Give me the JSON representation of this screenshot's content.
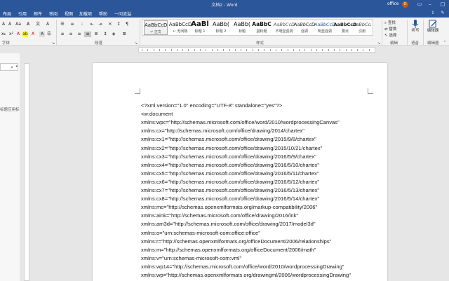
{
  "titlebar": {
    "title": "文档2 - Word",
    "user": "office",
    "avatar": "O",
    "colors": {
      "bar": "#2b579a"
    }
  },
  "tabs": {
    "items": [
      "布局",
      "引用",
      "邮件",
      "审阅",
      "视图",
      "加载项",
      "帮助",
      "一问流溢"
    ],
    "right_icons": [
      "share-icon",
      "comment-icon"
    ]
  },
  "ribbon": {
    "groups": {
      "font": "字体",
      "paragraph": "段落",
      "styles": "样式",
      "editing": "编辑",
      "voice": "语音",
      "editor": "编辑器"
    },
    "styles": [
      {
        "preview": "AaBbCcD",
        "label": "↵ 正文",
        "selected": true
      },
      {
        "preview": "AaBbCcD",
        "label": "↵ 无间隔",
        "selected": false
      },
      {
        "preview": "AaBl",
        "label": "标题 1",
        "selected": false
      },
      {
        "preview": "AaBb(",
        "label": "标题 2",
        "selected": false
      },
      {
        "preview": "AaBb(",
        "label": "标题",
        "selected": false
      },
      {
        "preview": "AaBbC",
        "label": "副标题",
        "selected": false
      },
      {
        "preview": "AaBbCcD",
        "label": "不明显强调",
        "selected": false
      },
      {
        "preview": "AaBbCcD",
        "label": "强调",
        "selected": false
      },
      {
        "preview": "AaBbCcD",
        "label": "明显强调",
        "selected": false
      },
      {
        "preview": "AaBbCcD",
        "label": "要点",
        "selected": false
      },
      {
        "preview": "AaBbCcD",
        "label": "引用",
        "selected": false
      }
    ],
    "editing": [
      "查找",
      "替换",
      "选择"
    ],
    "voice_label": "听写",
    "editor_label": "编辑器"
  },
  "navpane": {
    "hint": "标题应用标"
  },
  "document": {
    "lines": [
      "<?xml version=\"1.0\" encoding=\"UTF-8\" standalone=\"yes\"?>",
      "<w:document",
      "xmlns:wpc=\"http://schemas.microsoft.com/office/word/2010/wordprocessingCanvas\"",
      "xmlns:cx=\"http://schemas.microsoft.com/office/drawing/2014/chartex\"",
      "xmlns:cx1=\"http://schemas.microsoft.com/office/drawing/2015/9/8/chartex\"",
      "xmlns:cx2=\"http://schemas.microsoft.com/office/drawing/2015/10/21/chartex\"",
      "xmlns:cx3=\"http://schemas.microsoft.com/office/drawing/2016/5/9/chartex\"",
      "xmlns:cx4=\"http://schemas.microsoft.com/office/drawing/2016/5/10/chartex\"",
      "xmlns:cx5=\"http://schemas.microsoft.com/office/drawing/2016/5/11/chartex\"",
      "xmlns:cx6=\"http://schemas.microsoft.com/office/drawing/2016/5/12/chartex\"",
      "xmlns:cx7=\"http://schemas.microsoft.com/office/drawing/2016/5/13/chartex\"",
      "xmlns:cx8=\"http://schemas.microsoft.com/office/drawing/2016/5/14/chartex\"",
      "xmlns:mc=\"http://schemas.openxmlformats.org/markup-compatibility/2006\"",
      "xmlns:aink=\"http://schemas.microsoft.com/office/drawing/2016/ink\"",
      "xmlns:am3d=\"http://schemas.microsoft.com/office/drawing/2017/model3d\"",
      "xmlns:o=\"urn:schemas-microsoft-com:office:office\"",
      "xmlns:r=\"http://schemas.openxmlformats.org/officeDocument/2006/relationships\"",
      "xmlns:m=\"http://schemas.openxmlformats.org/officeDocument/2006/math\"",
      "xmlns:v=\"urn:schemas-microsoft-com:vml\"",
      "xmlns:wp14=\"http://schemas.microsoft.com/office/word/2010/wordprocessingDrawing\"",
      "xmlns:wp=\"http://schemas.openxmlformats.org/drawingml/2006/wordprocessingDrawing\""
    ]
  }
}
